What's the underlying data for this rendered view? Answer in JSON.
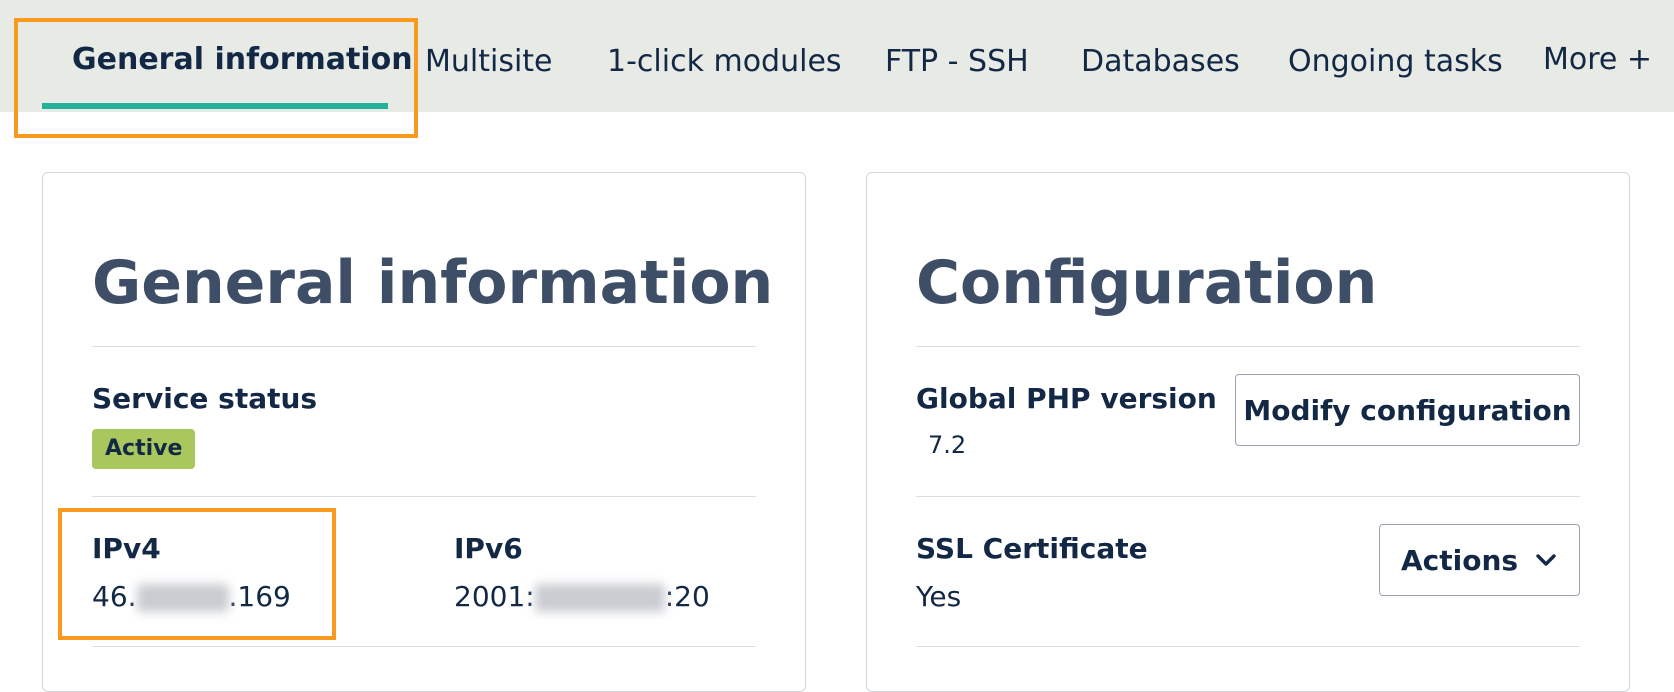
{
  "tabs": [
    {
      "label": "General information",
      "active": true
    },
    {
      "label": "Multisite"
    },
    {
      "label": "1-click modules"
    },
    {
      "label": "FTP - SSH"
    },
    {
      "label": "Databases"
    },
    {
      "label": "Ongoing tasks"
    },
    {
      "label": "More +"
    }
  ],
  "general_card": {
    "title": "General information",
    "service_status_label": "Service status",
    "service_status_value": "Active",
    "ipv4_label": "IPv4",
    "ipv4_prefix": "46.",
    "ipv4_suffix": ".169",
    "ipv6_label": "IPv6",
    "ipv6_prefix": "2001:",
    "ipv6_suffix": ":20"
  },
  "config_card": {
    "title": "Configuration",
    "php_label": "Global PHP version",
    "php_value": "7.2",
    "modify_button": "Modify configuration",
    "ssl_label": "SSL Certificate",
    "ssl_value": "Yes",
    "actions_button": "Actions"
  },
  "colors": {
    "accent_underline": "#22b39a",
    "highlight_frame": "#f79a1f",
    "active_badge": "#a9c75c",
    "tabbar_bg": "#e8eae6"
  }
}
